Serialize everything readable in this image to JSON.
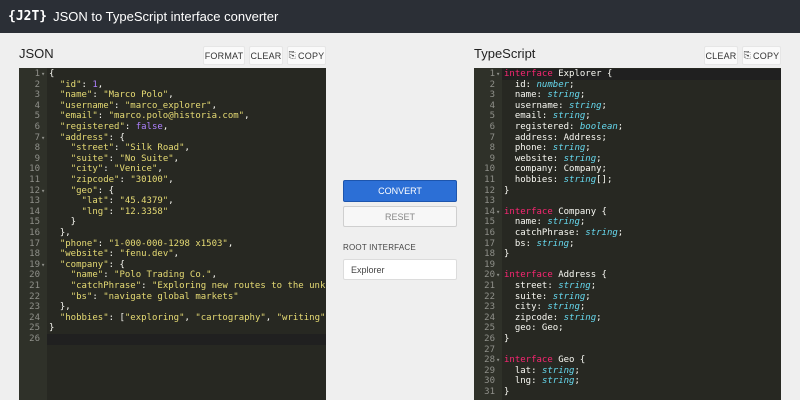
{
  "app": {
    "logo": "{J2T}",
    "title": "JSON to TypeScript interface converter"
  },
  "json_panel": {
    "title": "JSON",
    "buttons": {
      "format": "FORMAT",
      "clear": "CLEAR",
      "copy": "COPY"
    },
    "active_line": 26,
    "lines": [
      {
        "n": "1",
        "fold": "-",
        "html": "{"
      },
      {
        "n": "2",
        "html": "  <span class=\"s\">\"id\"</span>: <span class=\"n\">1</span>,"
      },
      {
        "n": "3",
        "html": "  <span class=\"s\">\"name\"</span>: <span class=\"s\">\"Marco Polo\"</span>,"
      },
      {
        "n": "4",
        "html": "  <span class=\"s\">\"username\"</span>: <span class=\"s\">\"marco_explorer\"</span>,"
      },
      {
        "n": "5",
        "html": "  <span class=\"s\">\"email\"</span>: <span class=\"s\">\"marco.polo@historia.com\"</span>,"
      },
      {
        "n": "6",
        "html": "  <span class=\"s\">\"registered\"</span>: <span class=\"n\">false</span>,"
      },
      {
        "n": "7",
        "fold": "-",
        "html": "  <span class=\"s\">\"address\"</span>: {"
      },
      {
        "n": "8",
        "html": "    <span class=\"s\">\"street\"</span>: <span class=\"s\">\"Silk Road\"</span>,"
      },
      {
        "n": "9",
        "html": "    <span class=\"s\">\"suite\"</span>: <span class=\"s\">\"No Suite\"</span>,"
      },
      {
        "n": "10",
        "html": "    <span class=\"s\">\"city\"</span>: <span class=\"s\">\"Venice\"</span>,"
      },
      {
        "n": "11",
        "html": "    <span class=\"s\">\"zipcode\"</span>: <span class=\"s\">\"30100\"</span>,"
      },
      {
        "n": "12",
        "fold": "-",
        "html": "    <span class=\"s\">\"geo\"</span>: {"
      },
      {
        "n": "13",
        "html": "      <span class=\"s\">\"lat\"</span>: <span class=\"s\">\"45.4379\"</span>,"
      },
      {
        "n": "14",
        "html": "      <span class=\"s\">\"lng\"</span>: <span class=\"s\">\"12.3358\"</span>"
      },
      {
        "n": "15",
        "html": "    }"
      },
      {
        "n": "16",
        "html": "  },"
      },
      {
        "n": "17",
        "html": "  <span class=\"s\">\"phone\"</span>: <span class=\"s\">\"1-000-000-1298 x1503\"</span>,"
      },
      {
        "n": "18",
        "html": "  <span class=\"s\">\"website\"</span>: <span class=\"s\">\"fenu.dev\"</span>,"
      },
      {
        "n": "19",
        "fold": "-",
        "html": "  <span class=\"s\">\"company\"</span>: {"
      },
      {
        "n": "20",
        "html": "    <span class=\"s\">\"name\"</span>: <span class=\"s\">\"Polo Trading Co.\"</span>,"
      },
      {
        "n": "21",
        "html": "    <span class=\"s\">\"catchPhrase\"</span>: <span class=\"s\">\"Exploring new routes to the unknown\"</span>,"
      },
      {
        "n": "22",
        "html": "    <span class=\"s\">\"bs\"</span>: <span class=\"s\">\"navigate global markets\"</span>"
      },
      {
        "n": "23",
        "html": "  },"
      },
      {
        "n": "24",
        "html": "  <span class=\"s\">\"hobbies\"</span>: [<span class=\"s\">\"exploring\"</span>, <span class=\"s\">\"cartography\"</span>, <span class=\"s\">\"writing\"</span>]"
      },
      {
        "n": "25",
        "html": "}"
      },
      {
        "n": "26",
        "html": ""
      }
    ]
  },
  "controls": {
    "convert": "CONVERT",
    "reset": "RESET",
    "root_label": "ROOT INTERFACE",
    "root_value": "Explorer"
  },
  "ts_panel": {
    "title": "TypeScript",
    "buttons": {
      "clear": "CLEAR",
      "copy": "COPY"
    },
    "active_line": 1,
    "lines": [
      {
        "n": "1",
        "fold": "-",
        "html": "<span class=\"k\">interface</span> Explorer {"
      },
      {
        "n": "2",
        "html": "  id: <span class=\"t\">number</span>;"
      },
      {
        "n": "3",
        "html": "  name: <span class=\"t\">string</span>;"
      },
      {
        "n": "4",
        "html": "  username: <span class=\"t\">string</span>;"
      },
      {
        "n": "5",
        "html": "  email: <span class=\"t\">string</span>;"
      },
      {
        "n": "6",
        "html": "  registered: <span class=\"t\">boolean</span>;"
      },
      {
        "n": "7",
        "html": "  address: Address;"
      },
      {
        "n": "8",
        "html": "  phone: <span class=\"t\">string</span>;"
      },
      {
        "n": "9",
        "html": "  website: <span class=\"t\">string</span>;"
      },
      {
        "n": "10",
        "html": "  company: Company;"
      },
      {
        "n": "11",
        "html": "  hobbies: <span class=\"t\">string</span>[];"
      },
      {
        "n": "12",
        "html": "}"
      },
      {
        "n": "13",
        "html": ""
      },
      {
        "n": "14",
        "fold": "-",
        "html": "<span class=\"k\">interface</span> Company {"
      },
      {
        "n": "15",
        "html": "  name: <span class=\"t\">string</span>;"
      },
      {
        "n": "16",
        "html": "  catchPhrase: <span class=\"t\">string</span>;"
      },
      {
        "n": "17",
        "html": "  bs: <span class=\"t\">string</span>;"
      },
      {
        "n": "18",
        "html": "}"
      },
      {
        "n": "19",
        "html": ""
      },
      {
        "n": "20",
        "fold": "-",
        "html": "<span class=\"k\">interface</span> Address {"
      },
      {
        "n": "21",
        "html": "  street: <span class=\"t\">string</span>;"
      },
      {
        "n": "22",
        "html": "  suite: <span class=\"t\">string</span>;"
      },
      {
        "n": "23",
        "html": "  city: <span class=\"t\">string</span>;"
      },
      {
        "n": "24",
        "html": "  zipcode: <span class=\"t\">string</span>;"
      },
      {
        "n": "25",
        "html": "  geo: Geo;"
      },
      {
        "n": "26",
        "html": "}"
      },
      {
        "n": "27",
        "html": ""
      },
      {
        "n": "28",
        "fold": "-",
        "html": "<span class=\"k\">interface</span> Geo {"
      },
      {
        "n": "29",
        "html": "  lat: <span class=\"t\">string</span>;"
      },
      {
        "n": "30",
        "html": "  lng: <span class=\"t\">string</span>;"
      },
      {
        "n": "31",
        "html": "}"
      }
    ]
  },
  "icons": {
    "copy": "copy-icon",
    "fold": "fold-arrow-icon"
  },
  "colors": {
    "topbar": "#2b2f36",
    "editor_bg": "#272822",
    "accent": "#2c6fd6",
    "keyword": "#f92672",
    "string": "#e6db74",
    "number": "#ae81ff",
    "type": "#66d9ef"
  }
}
